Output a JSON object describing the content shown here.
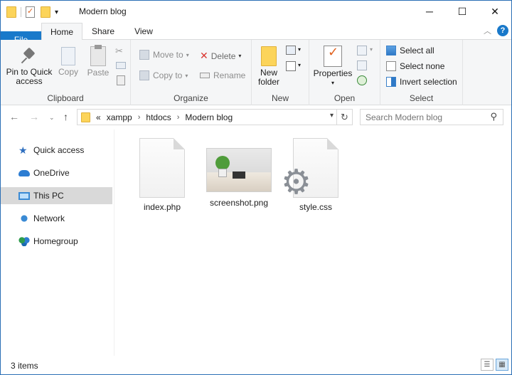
{
  "window": {
    "title": "Modern blog",
    "controls": {
      "minimize": "─",
      "maximize": "☐",
      "close": "✕"
    }
  },
  "ribbon_tabs": [
    {
      "label": "File"
    },
    {
      "label": "Home"
    },
    {
      "label": "Share"
    },
    {
      "label": "View"
    }
  ],
  "ribbon": {
    "clipboard": {
      "pin_label_1": "Pin to Quick",
      "pin_label_2": "access",
      "copy": "Copy",
      "paste": "Paste",
      "group": "Clipboard"
    },
    "organize": {
      "move_to": "Move to",
      "copy_to": "Copy to",
      "delete": "Delete",
      "rename": "Rename",
      "group": "Organize"
    },
    "new": {
      "new_folder_1": "New",
      "new_folder_2": "folder",
      "group": "New"
    },
    "open": {
      "properties": "Properties",
      "group": "Open"
    },
    "select": {
      "select_all": "Select all",
      "select_none": "Select none",
      "invert_selection": "Invert selection",
      "group": "Select"
    }
  },
  "address": {
    "prefix": "«",
    "breadcrumbs": [
      "xampp",
      "htdocs",
      "Modern blog"
    ],
    "separator": "›"
  },
  "search": {
    "placeholder": "Search Modern blog"
  },
  "nav_pane": [
    {
      "label": "Quick access",
      "icon": "star-icon"
    },
    {
      "label": "OneDrive",
      "icon": "cloud-icon"
    },
    {
      "label": "This PC",
      "icon": "computer-icon",
      "selected": true
    },
    {
      "label": "Network",
      "icon": "network-icon"
    },
    {
      "label": "Homegroup",
      "icon": "homegroup-icon"
    }
  ],
  "files": [
    {
      "name": "index.php",
      "icon": "blank-page-icon"
    },
    {
      "name": "screenshot.png",
      "icon": "image-thumbnail"
    },
    {
      "name": "style.css",
      "icon": "gear-page-icon"
    }
  ],
  "status": {
    "item_count": "3 items"
  }
}
